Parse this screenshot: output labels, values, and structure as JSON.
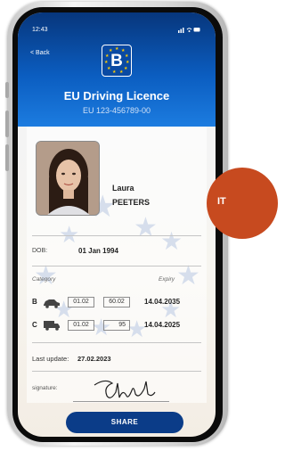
{
  "status_bar": {
    "time": "12:43",
    "icons": "signal wifi battery"
  },
  "nav": {
    "back_label": "< Back"
  },
  "header": {
    "logo_letter": "B",
    "title": "EU Driving Licence",
    "licence_number": "EU 123-456789-00",
    "colors": {
      "header_top": "#07367c",
      "header_bottom": "#1c7ce0",
      "star": "#ffcc00"
    }
  },
  "holder": {
    "first_name": "Laura",
    "last_name": "PEETERS"
  },
  "dob": {
    "label": "DOB:",
    "value": "01 Jan 1994"
  },
  "categories": {
    "header_category": "Category",
    "header_expiry": "Expiry",
    "rows": [
      {
        "letter": "B",
        "icon": "car-icon",
        "code": "01.02",
        "sub": "60.02",
        "expiry": "14.04.2035"
      },
      {
        "letter": "C",
        "icon": "truck-icon",
        "code": "01.02",
        "sub": "95",
        "expiry": "14.04.2025"
      }
    ]
  },
  "last_update": {
    "label": "Last update:",
    "value": "27.02.2023"
  },
  "signature": {
    "label": "signature:"
  },
  "actions": {
    "share_label": "SHARE",
    "share_color": "#0b3c88"
  },
  "badge": {
    "text": "IT",
    "color": "#c74a1f"
  }
}
